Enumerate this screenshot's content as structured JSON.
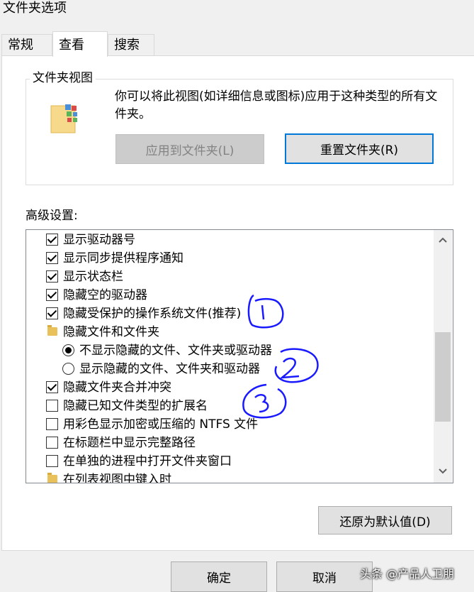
{
  "window": {
    "title": "文件夹选项"
  },
  "tabs": [
    {
      "label": "常规",
      "active": false
    },
    {
      "label": "查看",
      "active": true
    },
    {
      "label": "搜索",
      "active": false
    }
  ],
  "folder_view": {
    "group_label": "文件夹视图",
    "description": "你可以将此视图(如详细信息或图标)应用于这种类型的所有文件夹。",
    "apply_button": "应用到文件夹(L)",
    "reset_button": "重置文件夹(R)"
  },
  "advanced": {
    "label": "高级设置:",
    "items": [
      {
        "type": "checkbox",
        "checked": true,
        "label": "显示驱动器号"
      },
      {
        "type": "checkbox",
        "checked": true,
        "label": "显示同步提供程序通知"
      },
      {
        "type": "checkbox",
        "checked": true,
        "label": "显示状态栏"
      },
      {
        "type": "checkbox",
        "checked": true,
        "label": "隐藏空的驱动器"
      },
      {
        "type": "checkbox",
        "checked": true,
        "label": "隐藏受保护的操作系统文件(推荐)"
      },
      {
        "type": "folder",
        "label": "隐藏文件和文件夹"
      },
      {
        "type": "radio",
        "checked": true,
        "label": "不显示隐藏的文件、文件夹或驱动器"
      },
      {
        "type": "radio",
        "checked": false,
        "label": "显示隐藏的文件、文件夹和驱动器"
      },
      {
        "type": "checkbox",
        "checked": true,
        "label": "隐藏文件夹合并冲突"
      },
      {
        "type": "checkbox",
        "checked": false,
        "label": "隐藏已知文件类型的扩展名"
      },
      {
        "type": "checkbox",
        "checked": false,
        "label": "用彩色显示加密或压缩的 NTFS 文件"
      },
      {
        "type": "checkbox",
        "checked": false,
        "label": "在标题栏中显示完整路径"
      },
      {
        "type": "checkbox",
        "checked": false,
        "label": "在单独的进程中打开文件夹窗口"
      },
      {
        "type": "folder",
        "label": "在列表视图中键入时"
      }
    ],
    "restore_button": "还原为默认值(D)"
  },
  "footer": {
    "ok_button": "确定",
    "cancel_button": "取消"
  },
  "watermark": "头条 @产品人卫朋",
  "colors": {
    "annotation": "#1a1aff",
    "focus": "#0078d7",
    "folder": "#e8c15a"
  }
}
